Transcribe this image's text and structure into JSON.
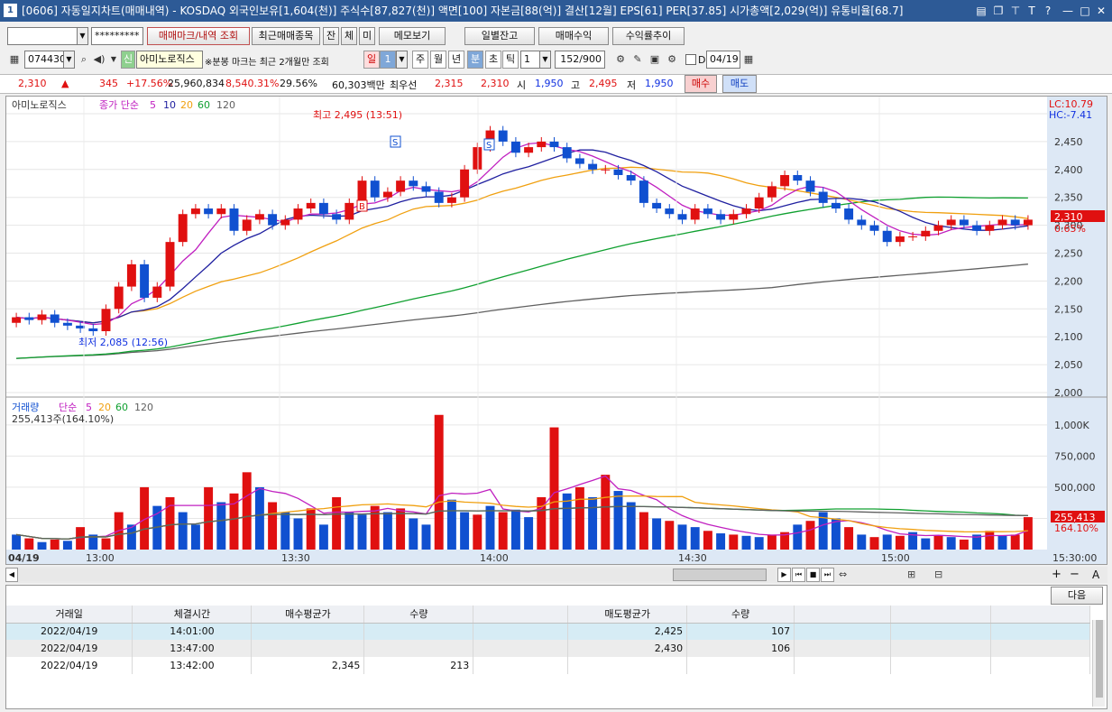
{
  "window": {
    "num": "1",
    "title": "[0606] 자동일지차트(매매내역) - KOSDAQ 외국인보유[1,604(천)] 주식수[87,827(천)] 액면[100] 자본금[88(억)] 결산[12월] EPS[61] PER[37.85] 시가총액[2,029(억)] 유통비율[68.7]",
    "icons": [
      "layout-icon",
      "restore-icon",
      "pin-icon",
      "font-icon",
      "help-icon",
      "minimize-icon",
      "maximize-icon",
      "close-icon"
    ],
    "icon_glyphs": {
      "layout": "▤",
      "restore": "❐",
      "pin": "⊤",
      "font": "T",
      "help": "?",
      "min": "—",
      "max": "□",
      "close": "✕"
    }
  },
  "toolbar1": {
    "account": "",
    "password": "*********",
    "btn_marks": "매매마크/내역 조회",
    "btn_recent": "최근매매종목",
    "btn_jan": "잔",
    "btn_che": "체",
    "btn_mi": "미",
    "btn_memo": "메모보기",
    "btn_daily": "일별잔고",
    "btn_profit": "매매수익",
    "btn_rate": "수익률추이"
  },
  "toolbar2": {
    "code": "074430",
    "sin": "신",
    "name": "아미노로직스",
    "notice": "※분봉 마크는 최근 2개월만 조회",
    "periods": [
      "일",
      "1",
      "주",
      "월",
      "년",
      "분",
      "초",
      "틱"
    ],
    "interval": "1",
    "count": "152/900",
    "date_checkbox": "D",
    "date": "04/19"
  },
  "quote": {
    "price": "2,310",
    "arrow": "▲",
    "change": "345",
    "change_pct": "+17.56%",
    "volume": "25,960,834",
    "vol_ratio": "8,540.31%",
    "turnover": "29.56%",
    "amount": "60,303백만",
    "best_label": "최우선",
    "best_ask": "2,315",
    "best_bid": "2,310",
    "open_label": "시",
    "open": "1,950",
    "high_label": "고",
    "high": "2,495",
    "low_label": "저",
    "low": "1,950",
    "buy_btn": "매수",
    "sell_btn": "매도"
  },
  "chart_data": [
    {
      "type": "candlestick",
      "title": "아미노로직스",
      "indicator_label": "종가 단순",
      "ma_periods": [
        "5",
        "10",
        "20",
        "60",
        "120"
      ],
      "ylim": [
        2000,
        2500
      ],
      "yticks": [
        "2,450",
        "2,400",
        "2,350",
        "2,300",
        "2,250",
        "2,200",
        "2,150",
        "2,100",
        "2,050",
        "2,000"
      ],
      "lc": "LC:10.79",
      "hc": "HC:-7.41",
      "current": "2,310",
      "current_pct": "0.65%",
      "annotations": {
        "high": "최고 2,495 (13:51)",
        "low": "최저 2,085 (12:56)",
        "sell_marks": [
          "S",
          "S"
        ],
        "buy_marks": [
          "B"
        ]
      },
      "close": [
        2135,
        2130,
        2140,
        2125,
        2120,
        2115,
        2110,
        2150,
        2190,
        2230,
        2170,
        2190,
        2270,
        2320,
        2330,
        2320,
        2330,
        2290,
        2310,
        2320,
        2300,
        2310,
        2330,
        2340,
        2320,
        2310,
        2340,
        2380,
        2350,
        2360,
        2380,
        2370,
        2360,
        2340,
        2350,
        2400,
        2440,
        2470,
        2450,
        2430,
        2440,
        2450,
        2440,
        2420,
        2410,
        2400,
        2400,
        2390,
        2380,
        2340,
        2330,
        2320,
        2310,
        2330,
        2320,
        2310,
        2320,
        2330,
        2350,
        2370,
        2390,
        2380,
        2360,
        2340,
        2330,
        2310,
        2300,
        2290,
        2270,
        2280,
        2280,
        2290,
        2300,
        2310,
        2300,
        2290,
        2300,
        2310,
        2300,
        2310
      ],
      "colors": {
        "up": "#e01010",
        "down": "#1050d0",
        "ma5": "#c020c0",
        "ma10": "#2020a0",
        "ma20": "#f0a010",
        "ma60": "#10a030",
        "ma120": "#606060"
      }
    },
    {
      "type": "bar",
      "title": "거래량",
      "indicator_label": "단순",
      "ma_periods": [
        "5",
        "20",
        "60",
        "120"
      ],
      "current_label": "255,413주(164.10%)",
      "current": "255,413",
      "current_pct": "164.10%",
      "yticks": [
        "1,000K",
        "750,000",
        "500,000",
        "250,000"
      ],
      "ylim": [
        0,
        1100000
      ],
      "xticks": [
        "04/19",
        "13:00",
        "13:30",
        "14:00",
        "14:30",
        "15:00",
        "15:30:00"
      ],
      "values": [
        120000,
        90000,
        60000,
        80000,
        70000,
        180000,
        120000,
        90000,
        300000,
        200000,
        500000,
        350000,
        420000,
        300000,
        200000,
        500000,
        380000,
        450000,
        620000,
        500000,
        380000,
        300000,
        250000,
        330000,
        200000,
        420000,
        300000,
        280000,
        350000,
        300000,
        330000,
        250000,
        200000,
        1080000,
        400000,
        300000,
        280000,
        350000,
        300000,
        320000,
        260000,
        420000,
        980000,
        450000,
        500000,
        420000,
        600000,
        470000,
        380000,
        300000,
        250000,
        230000,
        200000,
        180000,
        150000,
        130000,
        120000,
        110000,
        100000,
        120000,
        140000,
        200000,
        230000,
        300000,
        250000,
        180000,
        120000,
        100000,
        120000,
        110000,
        140000,
        90000,
        110000,
        100000,
        80000,
        120000,
        150000,
        110000,
        120000,
        260000
      ],
      "up": [
        0,
        1,
        0,
        1,
        0,
        1,
        0,
        1,
        1,
        0,
        1,
        0,
        1,
        0,
        0,
        1,
        0,
        1,
        1,
        0,
        1,
        0,
        0,
        1,
        0,
        1,
        0,
        0,
        1,
        0,
        1,
        0,
        0,
        1,
        0,
        0,
        1,
        0,
        1,
        0,
        0,
        1,
        1,
        0,
        1,
        0,
        1,
        0,
        0,
        1,
        0,
        1,
        0,
        0,
        1,
        0,
        1,
        0,
        0,
        1,
        1,
        0,
        1,
        0,
        0,
        1,
        0,
        1,
        0,
        1,
        0,
        0,
        1,
        0,
        1,
        0,
        1,
        0,
        1,
        1
      ]
    }
  ],
  "navbar": {
    "icons": [
      "scroll-left-icon",
      "play-icon",
      "first-icon",
      "stop-icon",
      "last-icon",
      "zoom-slider",
      "grid-icon",
      "compare-icon",
      "zoom-in-icon",
      "zoom-out-icon",
      "auto-icon"
    ],
    "glyphs": [
      "◀",
      "▶",
      "⏮",
      "■",
      "⏭",
      "⇔",
      "⊞",
      "⊟",
      "+",
      "−",
      "A"
    ]
  },
  "table": {
    "next_btn": "다음",
    "headers": [
      "거래일",
      "체결시간",
      "매수평균가",
      "수량",
      "",
      "매도평균가",
      "수량",
      "",
      "",
      ""
    ],
    "rows": [
      [
        "2022/04/19",
        "14:01:00",
        "",
        "",
        "",
        "2,425",
        "107",
        "",
        "",
        ""
      ],
      [
        "2022/04/19",
        "13:47:00",
        "",
        "",
        "",
        "2,430",
        "106",
        "",
        "",
        ""
      ],
      [
        "2022/04/19",
        "13:42:00",
        "2,345",
        "213",
        "",
        "",
        "",
        "",
        "",
        ""
      ]
    ]
  }
}
